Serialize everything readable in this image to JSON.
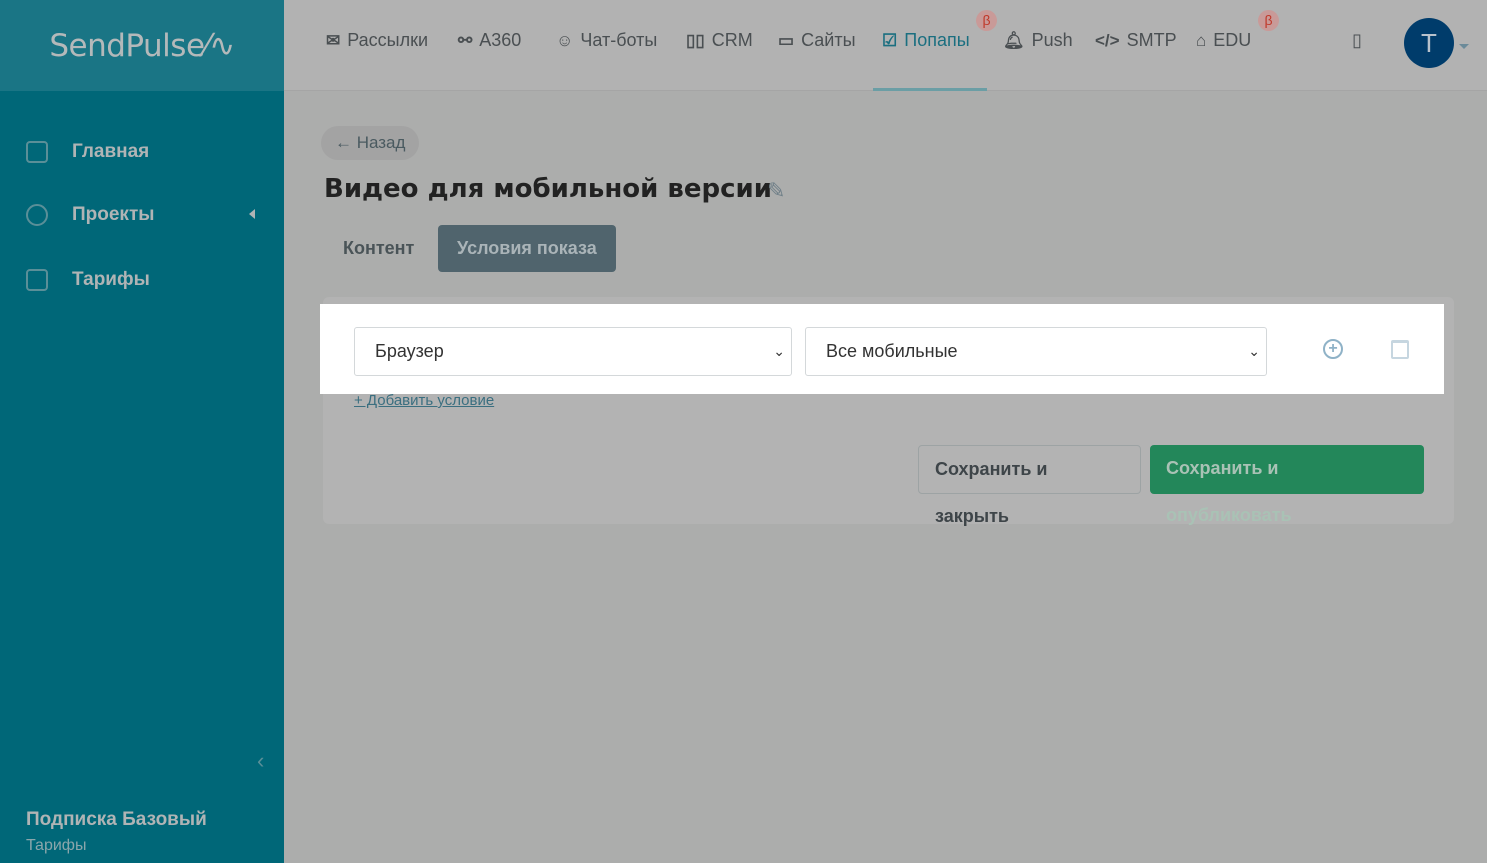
{
  "logo": "SendPulse",
  "sidebar": {
    "items": [
      {
        "label": "Главная"
      },
      {
        "label": "Проекты"
      },
      {
        "label": "Тарифы"
      }
    ],
    "subscription": "Подписка Базовый",
    "plans_link": "Тарифы"
  },
  "nav": {
    "items": [
      "Рассылки",
      "A360",
      "Чат-боты",
      "CRM",
      "Сайты",
      "Попапы",
      "Push",
      "SMTP",
      "EDU"
    ],
    "beta": "β",
    "avatar": "T"
  },
  "page": {
    "back": "← Назад",
    "title": "Видео для мобильной версии",
    "tabs": [
      "Контент",
      "Условия показа"
    ]
  },
  "condition": {
    "type": "Браузер",
    "value": "Все мобильные"
  },
  "add_condition": "+ Добавить условие",
  "buttons": {
    "save_close": "Сохранить и закрыть",
    "save_publish": "Сохранить и опубликовать"
  }
}
